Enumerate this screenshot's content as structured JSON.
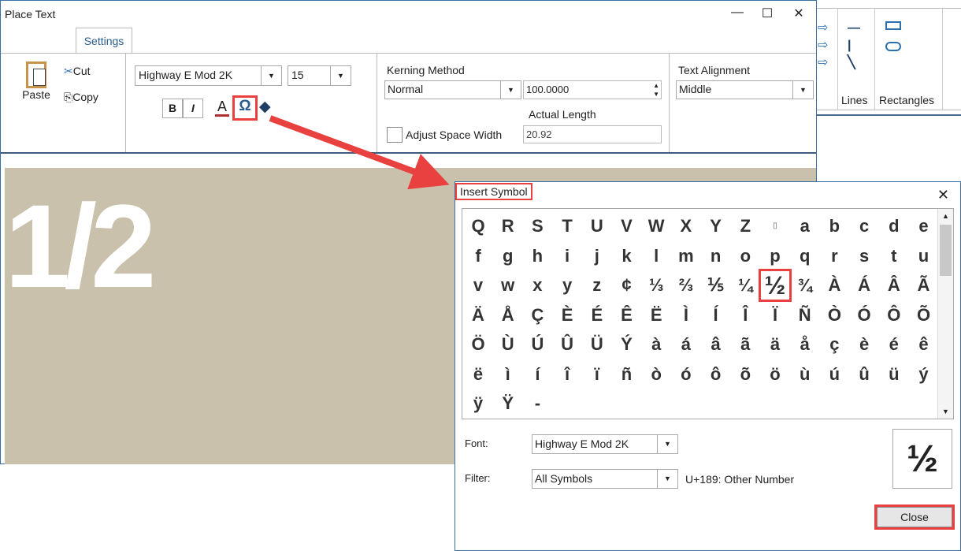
{
  "background_ribbon": {
    "groups": [
      "Lines",
      "Rectangles"
    ]
  },
  "main_window": {
    "title": "Place Text",
    "tab": "Settings",
    "clipboard": {
      "paste": "Paste",
      "cut": "Cut",
      "copy": "Copy"
    },
    "font": {
      "name": "Highway E Mod 2K",
      "size": "15",
      "bold": "B",
      "italic": "I",
      "color_label": "A",
      "symbol_label": "Ω"
    },
    "kerning": {
      "label": "Kerning Method",
      "method": "Normal",
      "value": "100.0000",
      "actual_length_label": "Actual Length",
      "actual_length": "20.92",
      "adjust_space_label": "Adjust Space Width",
      "adjust_space_checked": false
    },
    "alignment": {
      "label": "Text Alignment",
      "value": "Middle"
    },
    "preview_text": "1/2"
  },
  "insert_symbol": {
    "title": "Insert Symbol",
    "symbols": [
      [
        "Q",
        "R",
        "S",
        "T",
        "U",
        "V",
        "W",
        "X",
        "Y",
        "Z",
        "▯",
        "a",
        "b",
        "c",
        "d",
        "e"
      ],
      [
        "f",
        "g",
        "h",
        "i",
        "j",
        "k",
        "l",
        "m",
        "n",
        "o",
        "p",
        "q",
        "r",
        "s",
        "t",
        "u"
      ],
      [
        "v",
        "w",
        "x",
        "y",
        "z",
        "¢",
        "⅓",
        "⅔",
        "⅕",
        "¼",
        "½",
        "¾",
        "À",
        "Á",
        "Â",
        "Ã"
      ],
      [
        "Ä",
        "Å",
        "Ç",
        "È",
        "É",
        "Ê",
        "Ë",
        "Ì",
        "Í",
        "Î",
        "Ï",
        "Ñ",
        "Ò",
        "Ó",
        "Ô",
        "Õ"
      ],
      [
        "Ö",
        "Ù",
        "Ú",
        "Û",
        "Ü",
        "Ý",
        "à",
        "á",
        "â",
        "ã",
        "ä",
        "å",
        "ç",
        "è",
        "é",
        "ê"
      ],
      [
        "ë",
        "ì",
        "í",
        "î",
        "ï",
        "ñ",
        "ò",
        "ó",
        "ô",
        "õ",
        "ö",
        "ù",
        "ú",
        "û",
        "ü",
        "ý"
      ],
      [
        "ÿ",
        "Ÿ",
        "-"
      ]
    ],
    "selected": "½",
    "font_label": "Font:",
    "font_value": "Highway E Mod 2K",
    "filter_label": "Filter:",
    "filter_value": "All Symbols",
    "code_info": "U+189: Other Number",
    "preview": "½",
    "close_label": "Close"
  },
  "colors": {
    "highlight": "#e9413f",
    "canvas": "#c9c1ab",
    "accent": "#2a5d8f"
  }
}
